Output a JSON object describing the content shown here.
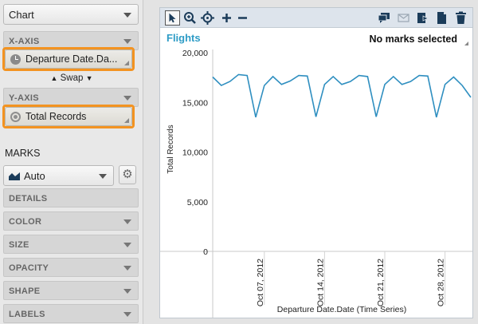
{
  "left_panel": {
    "chart_type": "Chart",
    "x_axis": {
      "label": "X-AXIS",
      "pill": "Departure Date.Da..."
    },
    "swap_label": "Swap",
    "y_axis": {
      "label": "Y-AXIS",
      "pill": "Total Records"
    },
    "marks_label": "MARKS",
    "marks_type": "Auto",
    "sections": [
      "DETAILS",
      "COLOR",
      "SIZE",
      "OPACITY",
      "SHAPE",
      "LABELS"
    ]
  },
  "toolbar": {
    "left_icons": [
      "select-arrow-icon",
      "zoom-icon",
      "pan-icon",
      "plus-icon",
      "minus-icon"
    ],
    "right_icons": [
      "comment-icon",
      "mail-icon",
      "export-icon",
      "document-icon",
      "trash-icon"
    ]
  },
  "chart_title": "Flights",
  "marks_status": "No marks selected",
  "colors": {
    "line": "#2f8fc0",
    "title": "#2e9cc6",
    "highlight": "#f39321"
  },
  "chart_data": {
    "type": "line",
    "title": "",
    "xlabel": "Departure Date.Date (Time Series)",
    "ylabel": "Total Records",
    "ylim": [
      0,
      20000
    ],
    "yticks": [
      "20,000",
      "15,000",
      "10,000",
      "5,000",
      "0"
    ],
    "xticks": [
      "Oct 07, 2012",
      "Oct 14, 2012",
      "Oct 21, 2012",
      "Oct 28, 2012"
    ],
    "x_start": "2012-10-01",
    "series": [
      {
        "values": [
          17550,
          16700,
          17100,
          17800,
          17700,
          13500,
          16700,
          17600,
          16800,
          17150,
          17700,
          17650,
          13550,
          16800,
          17600,
          16800,
          17100,
          17700,
          17600,
          13550,
          16800,
          17600,
          16800,
          17100,
          17700,
          17650,
          13500,
          16800,
          17550,
          16700,
          15500
        ]
      }
    ]
  }
}
